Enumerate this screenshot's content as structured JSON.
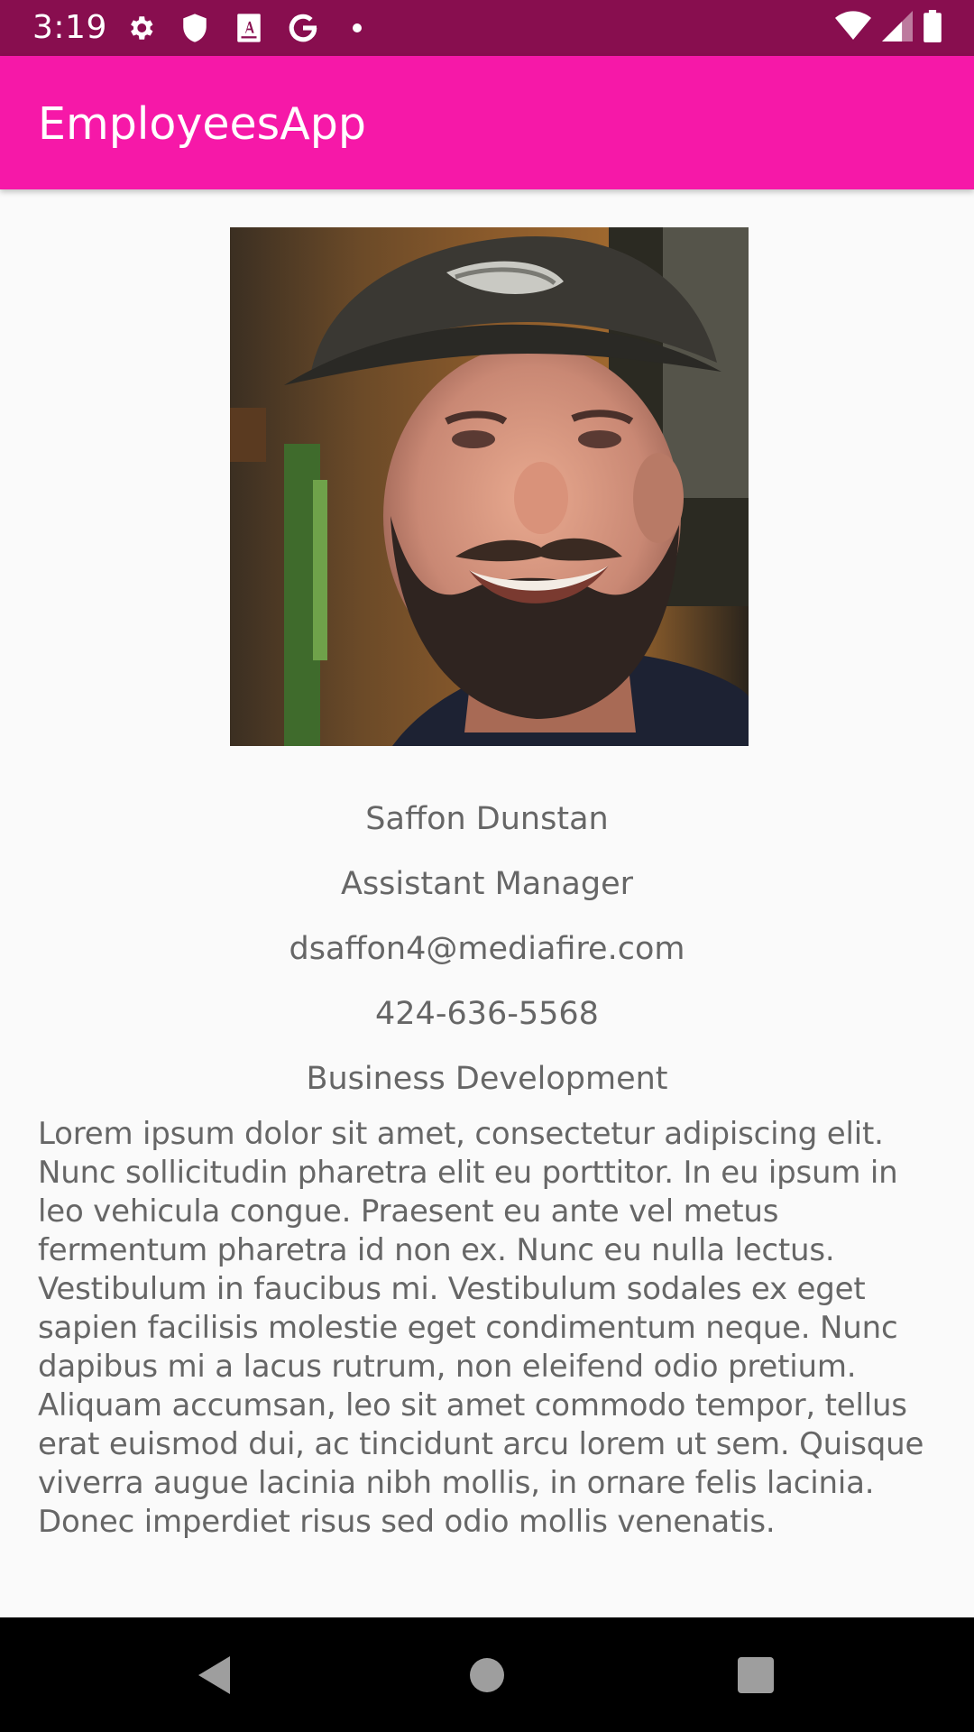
{
  "status_bar": {
    "time": "3:19",
    "background": "#880e4f",
    "icons_left": [
      "gear-icon",
      "shield-icon",
      "a-box-icon",
      "google-g-icon",
      "dot-icon"
    ],
    "icons_right": [
      "wifi-icon",
      "signal-icon",
      "battery-icon"
    ]
  },
  "app_bar": {
    "title": "EmployeesApp",
    "background": "#f618a8"
  },
  "employee": {
    "name": "Saffon Dunstan",
    "title": "Assistant Manager",
    "email": "dsaffon4@mediafire.com",
    "phone": "424-636-5568",
    "department": "Business Development",
    "bio": "Lorem ipsum dolor sit amet, consectetur adipiscing elit. Nunc sollicitudin pharetra elit eu porttitor. In eu ipsum in leo vehicula congue. Praesent eu ante vel metus fermentum pharetra id non ex. Nunc eu nulla lectus. Vestibulum in faucibus mi. Vestibulum sodales ex eget sapien facilisis molestie eget condimentum neque. Nunc dapibus mi a lacus rutrum, non eleifend odio pretium. Aliquam accumsan, leo sit amet commodo tempor, tellus erat euismod dui, ac tincidunt arcu lorem ut sem. Quisque viverra augue lacinia nibh mollis, in ornare felis lacinia. Donec imperdiet risus sed odio mollis venenatis."
  },
  "nav_bar": {
    "buttons": [
      "back-icon",
      "home-icon",
      "recents-icon"
    ]
  }
}
